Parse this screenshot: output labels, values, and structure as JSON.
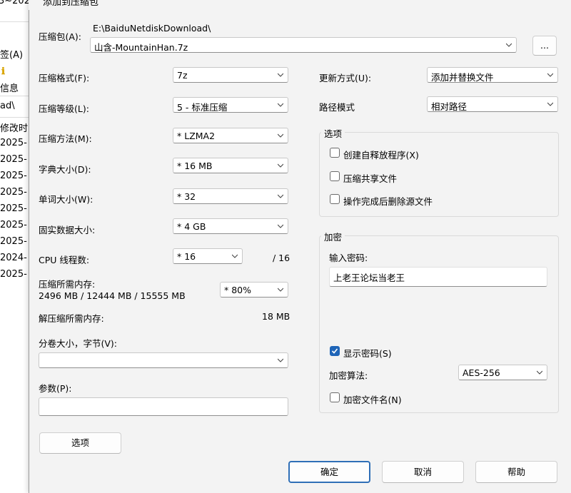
{
  "background": {
    "title_fragment": "3~202",
    "menu_fragment": "签(A)",
    "info_fragment": "信息",
    "path_fragment": "ad\\",
    "col_fragment": "修改时",
    "dates": [
      "2025-",
      "2025-",
      "2025-",
      "2025-",
      "2025-",
      "2025-",
      "2025-",
      "2024-",
      "2025-"
    ]
  },
  "dialog": {
    "title": "添加到压缩包",
    "archive": {
      "label": "压缩包(A):",
      "dir": "E:\\BaiduNetdiskDownload\\",
      "name": "山含-MountainHan.7z",
      "browse_label": "..."
    },
    "left": {
      "format_label": "压缩格式(F):",
      "format_value": "7z",
      "level_label": "压缩等级(L):",
      "level_value": "5 - 标准压缩",
      "method_label": "压缩方法(M):",
      "method_value": "*  LZMA2",
      "dict_label": "字典大小(D):",
      "dict_value": "*  16 MB",
      "word_label": "单词大小(W):",
      "word_value": "*  32",
      "solid_label": "固实数据大小:",
      "solid_value": "*  4 GB",
      "threads_label": "CPU 线程数:",
      "threads_value": "*  16",
      "threads_max": "/ 16",
      "mem_label": "压缩所需内存:",
      "mem_detail": "2496 MB / 12444 MB / 15555 MB",
      "mem_value": "*  80%",
      "decomp_label": "解压缩所需内存:",
      "decomp_value": "18 MB",
      "volume_label": "分卷大小，字节(V):",
      "volume_value": "",
      "params_label": "参数(P):",
      "params_value": "",
      "options_button": "选项"
    },
    "right": {
      "update_label": "更新方式(U):",
      "update_value": "添加并替换文件",
      "path_label": "路径模式",
      "path_value": "相对路径",
      "options_group": "选项",
      "opt_sfx": "创建自释放程序(X)",
      "opt_shared": "压缩共享文件",
      "opt_delete": "操作完成后删除源文件",
      "encrypt_group": "加密",
      "password_label": "输入密码:",
      "password_value": "上老王论坛当老王",
      "show_password": "显示密码(S)",
      "algo_label": "加密算法:",
      "algo_value": "AES-256",
      "encrypt_names": "加密文件名(N)"
    },
    "buttons": {
      "ok": "确定",
      "cancel": "取消",
      "help": "帮助"
    },
    "checkbox_state": {
      "sfx": false,
      "shared": false,
      "delete": false,
      "show_password": true,
      "encrypt_names": false
    },
    "colors": {
      "accent": "#1f65b8",
      "dialog_bg": "#f3f3f3"
    }
  }
}
